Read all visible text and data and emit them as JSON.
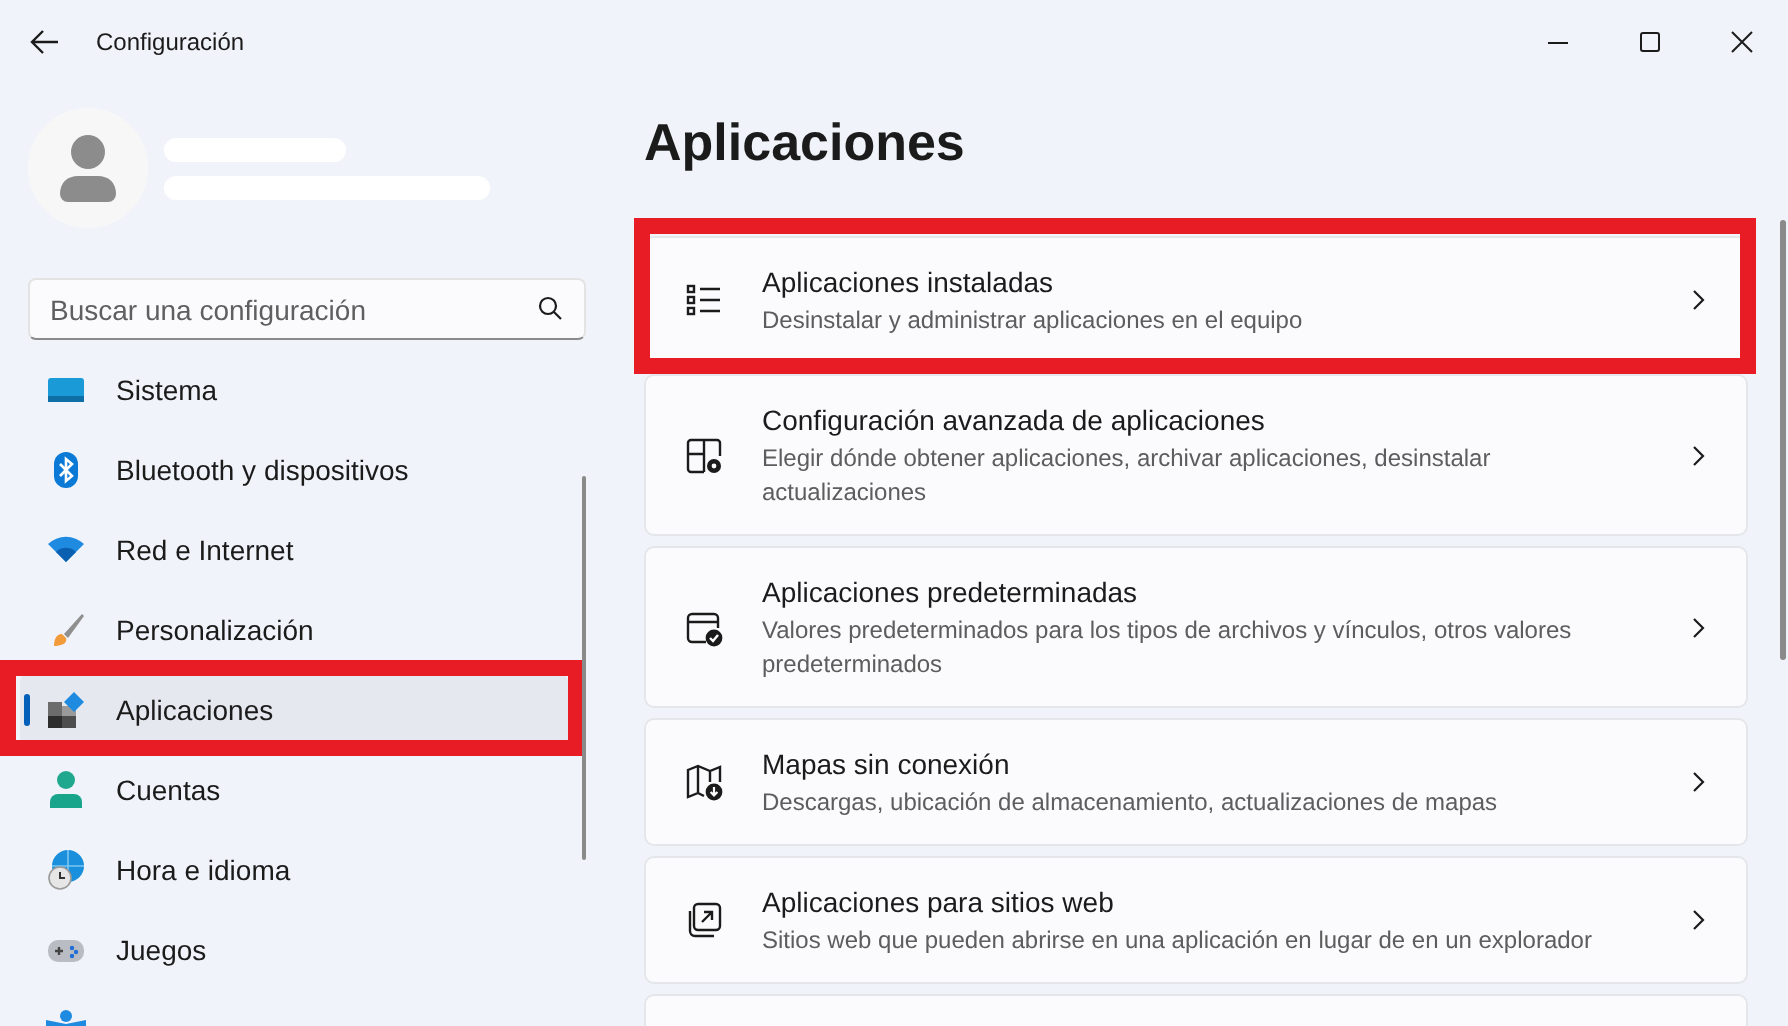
{
  "window": {
    "title": "Configuración"
  },
  "search": {
    "placeholder": "Buscar una configuración"
  },
  "sidebar": {
    "items": [
      {
        "label": "Sistema",
        "kind": "system",
        "selected": false,
        "highlighted": false
      },
      {
        "label": "Bluetooth y dispositivos",
        "kind": "bluetooth",
        "selected": false,
        "highlighted": false
      },
      {
        "label": "Red e Internet",
        "kind": "wifi",
        "selected": false,
        "highlighted": false
      },
      {
        "label": "Personalización",
        "kind": "brush",
        "selected": false,
        "highlighted": false
      },
      {
        "label": "Aplicaciones",
        "kind": "apps",
        "selected": true,
        "highlighted": true
      },
      {
        "label": "Cuentas",
        "kind": "person",
        "selected": false,
        "highlighted": false
      },
      {
        "label": "Hora e idioma",
        "kind": "clock",
        "selected": false,
        "highlighted": false
      },
      {
        "label": "Juegos",
        "kind": "gamepad",
        "selected": false,
        "highlighted": false
      },
      {
        "kind": "accessibility",
        "selected": false,
        "highlighted": false
      }
    ]
  },
  "page": {
    "heading": "Aplicaciones"
  },
  "cards": [
    {
      "title": "Aplicaciones instaladas",
      "description": "Desinstalar y administrar aplicaciones en el equipo",
      "kind": "list",
      "highlighted": true
    },
    {
      "title": "Configuración avanzada de aplicaciones",
      "description": "Elegir dónde obtener aplicaciones, archivar aplicaciones, desinstalar actualizaciones",
      "kind": "gear",
      "highlighted": false
    },
    {
      "title": "Aplicaciones predeterminadas",
      "description": "Valores predeterminados para los tipos de archivos y vínculos, otros valores predeterminados",
      "kind": "check",
      "highlighted": false
    },
    {
      "title": "Mapas sin conexión",
      "description": "Descargas, ubicación de almacenamiento, actualizaciones de mapas",
      "kind": "map",
      "highlighted": false
    },
    {
      "title": "Aplicaciones para sitios web",
      "description": "Sitios web que pueden abrirse en una aplicación en lugar de en un explorador",
      "kind": "web",
      "highlighted": false
    },
    {
      "kind": "blank",
      "highlighted": false
    }
  ]
}
